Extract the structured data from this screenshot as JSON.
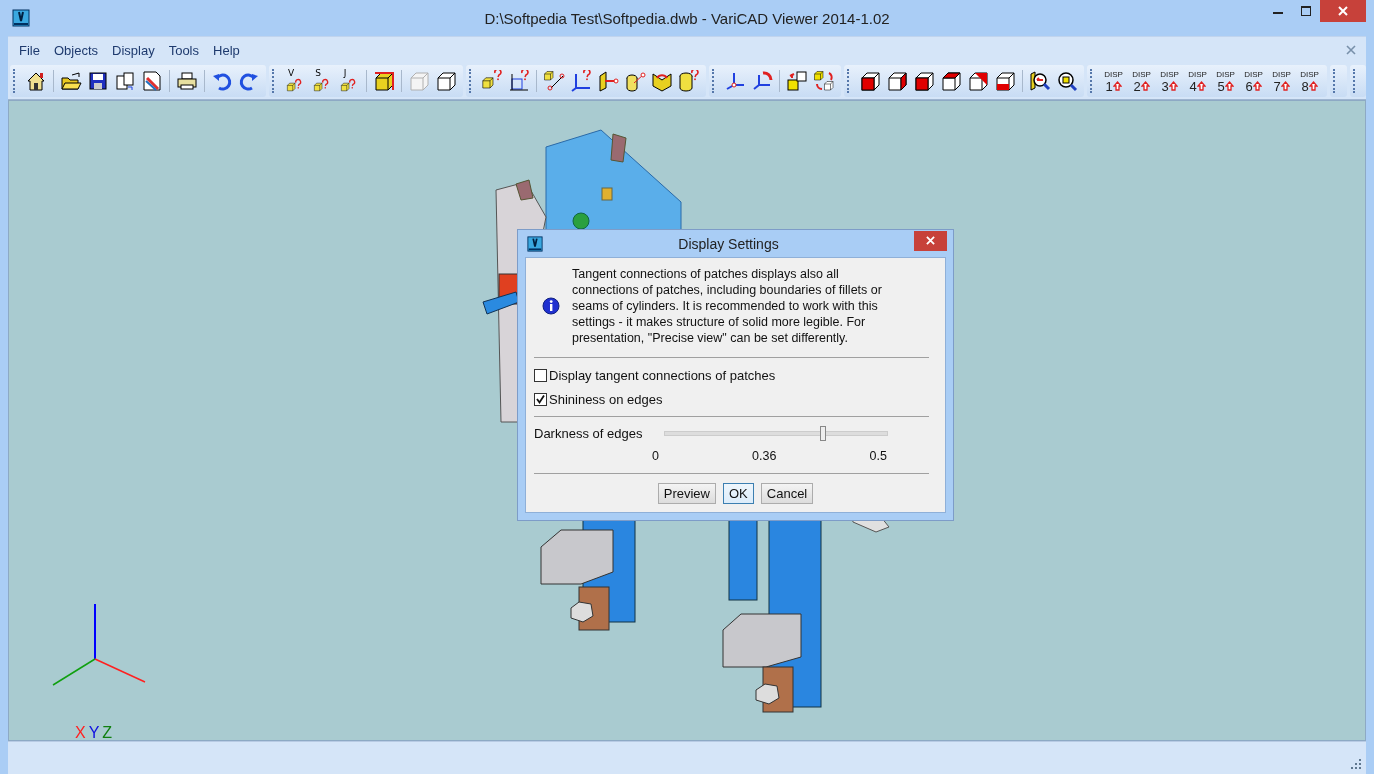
{
  "window": {
    "title": "D:\\Softpedia Test\\Softpedia.dwb - VariCAD Viewer 2014-1.02"
  },
  "menu": [
    "File",
    "Objects",
    "Display",
    "Tools",
    "Help"
  ],
  "toolbar": {
    "query_letters": [
      "V",
      "S",
      "J"
    ],
    "disp_buttons": [
      {
        "label": "DISP",
        "number": "1"
      },
      {
        "label": "DISP",
        "number": "2"
      },
      {
        "label": "DISP",
        "number": "3"
      },
      {
        "label": "DISP",
        "number": "4"
      },
      {
        "label": "DISP",
        "number": "5"
      },
      {
        "label": "DISP",
        "number": "6"
      },
      {
        "label": "DISP",
        "number": "7"
      },
      {
        "label": "DISP",
        "number": "8"
      }
    ]
  },
  "axes": [
    {
      "text": "X",
      "color": "#ff2020"
    },
    {
      "text": "Y",
      "color": "#1010e0"
    },
    {
      "text": "Z",
      "color": "#108010"
    }
  ],
  "dialog": {
    "title": "Display Settings",
    "message": "Tangent connections of patches displays also all connections of patches, including boundaries of fillets or seams of cylinders. It is recommended to work with this settings - it makes structure of solid more legible. For presentation, \"Precise view\" can be set differently.",
    "checkboxes": [
      {
        "label": "Display tangent connections of patches",
        "checked": false
      },
      {
        "label": "Shininess on edges",
        "checked": true
      }
    ],
    "slider": {
      "label": "Darkness of edges",
      "level": 0.71,
      "ticks": [
        "0",
        "0.36",
        "0.5"
      ]
    },
    "buttons": [
      {
        "label": "Preview",
        "focused": false
      },
      {
        "label": "OK",
        "focused": true
      },
      {
        "label": "Cancel",
        "focused": false
      }
    ]
  }
}
